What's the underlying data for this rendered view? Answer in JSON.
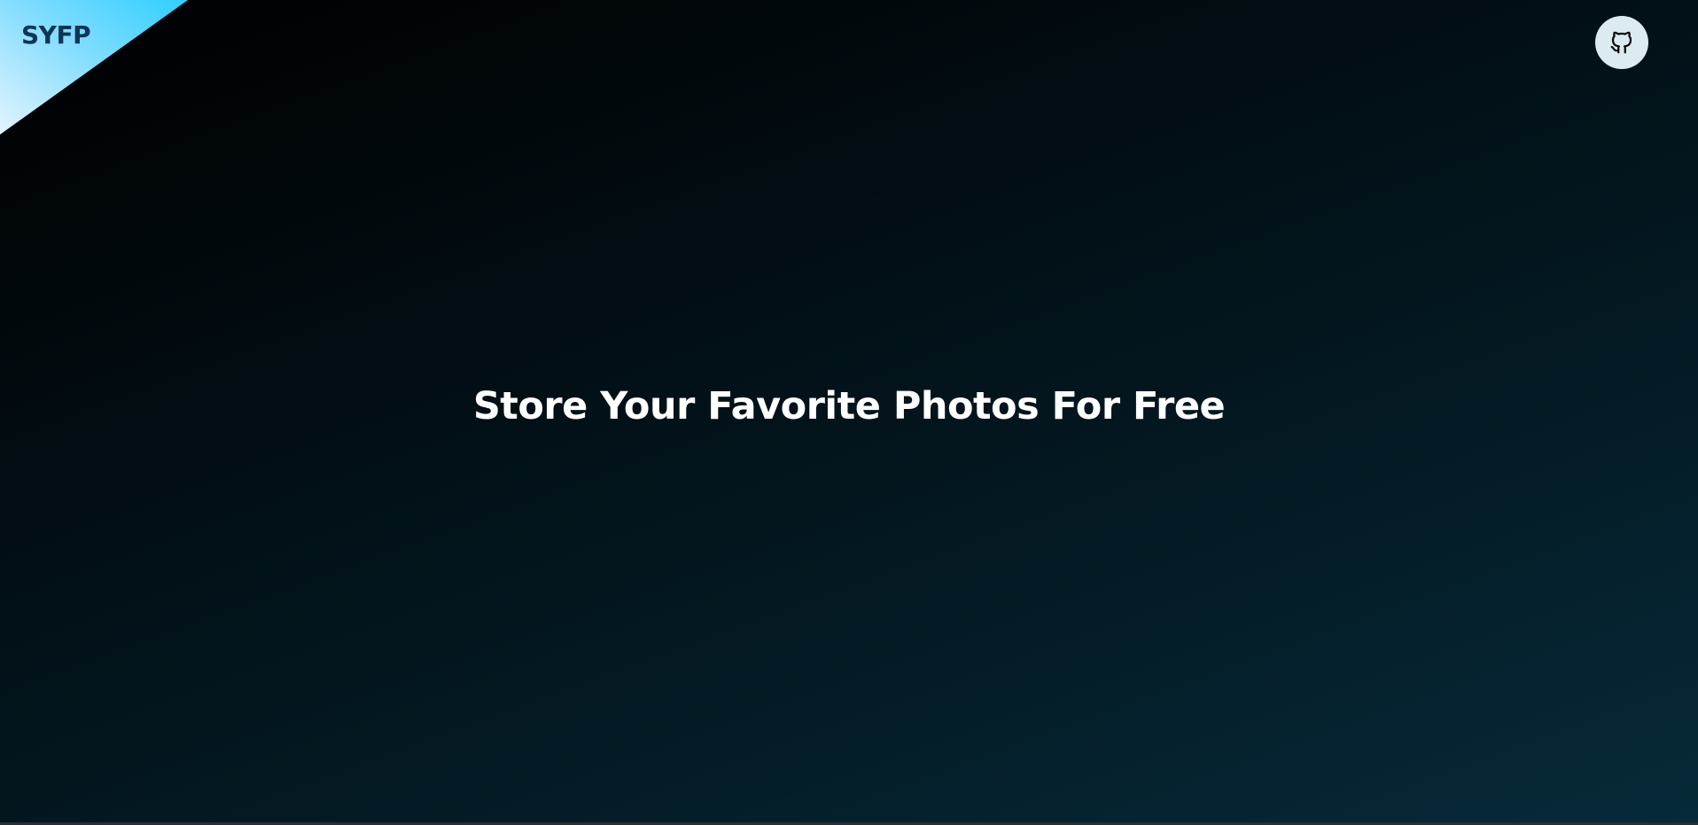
{
  "header": {
    "logo_text": "SYFP",
    "github_icon": "github-icon"
  },
  "hero": {
    "title": "Store Your Favorite Photos For Free"
  },
  "colors": {
    "banner_gradient_start": "#e4f4ff",
    "banner_gradient_end": "#2fcfff",
    "logo_text": "#0e3555",
    "github_button_bg": "#dcebef",
    "background_start": "#000000",
    "background_end": "#062a3a",
    "title_text": "#ffffff"
  }
}
